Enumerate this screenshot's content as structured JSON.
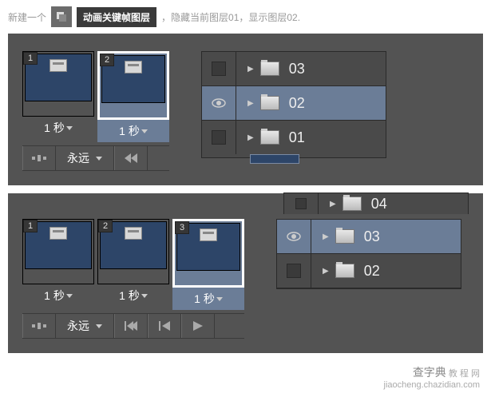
{
  "header": {
    "prefix": "新建一个",
    "highlight": "动画关键帧图层",
    "suffix": "，隐藏当前图层01，显示图层02."
  },
  "panel1": {
    "frames": [
      {
        "num": "1",
        "duration": "1 秒",
        "selected": false
      },
      {
        "num": "2",
        "duration": "1 秒",
        "selected": true
      }
    ],
    "loop": "永远",
    "layers": [
      {
        "name": "03",
        "visible": false,
        "selected": false
      },
      {
        "name": "02",
        "visible": true,
        "selected": true
      },
      {
        "name": "01",
        "visible": false,
        "selected": false
      }
    ]
  },
  "panel2": {
    "extra_layer": "04",
    "frames": [
      {
        "num": "1",
        "duration": "1 秒",
        "selected": false
      },
      {
        "num": "2",
        "duration": "1 秒",
        "selected": false
      },
      {
        "num": "3",
        "duration": "1 秒",
        "selected": true
      }
    ],
    "loop": "永远",
    "layers": [
      {
        "name": "03",
        "visible": true,
        "selected": true
      },
      {
        "name": "02",
        "visible": false,
        "selected": false
      }
    ]
  },
  "watermark": {
    "brand": "查字典",
    "site": "教 程 网",
    "url": "jiaocheng.chazidian.com"
  }
}
